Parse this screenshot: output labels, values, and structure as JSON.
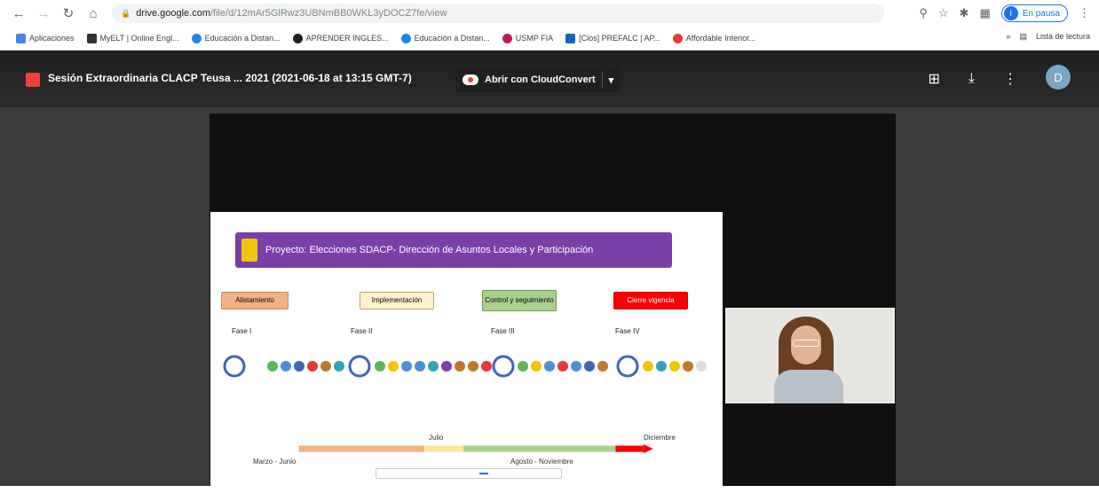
{
  "browser": {
    "url_host": "drive.google.com",
    "url_path": "/file/d/12mAr5GlRwz3UBNmBB0WKL3yDOCZ7fe/view",
    "profile_status": "En pausa",
    "profile_initial": "I",
    "bookmarks": [
      {
        "label": "Aplicaciones",
        "color": "#4285f4"
      },
      {
        "label": "MyELT | Online Engl...",
        "color": "#333333"
      },
      {
        "label": "Educación a Distan...",
        "color": "#1e88e5"
      },
      {
        "label": "APRENDER INGLES...",
        "color": "#222222"
      },
      {
        "label": "Educación a Distan...",
        "color": "#1e88e5"
      },
      {
        "label": "USMP FIA",
        "color": "#c2185b"
      },
      {
        "label": "[Clos] PREFALC | AP...",
        "color": "#1565c0"
      },
      {
        "label": "Affordable Interior...",
        "color": "#e53935"
      }
    ],
    "reading_list": "Lista de lectura"
  },
  "viewer": {
    "file_title": "Sesión Extraordinaria CLACP Teusa ... 2021 (2021-06-18 at 13:15 GMT-7)",
    "open_with_label": "Abrir con CloudConvert",
    "account_initial": "D"
  },
  "slide": {
    "title": "Proyecto: Elecciones SDACP- Dirección de Asuntos Locales y Participación",
    "phases": [
      {
        "label": "Alistamiento",
        "color": "#f4b183"
      },
      {
        "label": "Implementación",
        "color": "#fff2cc"
      },
      {
        "label": "Control y seguimiento",
        "color": "#a9d18e"
      },
      {
        "label": "Cierre vigencia",
        "color": "#ff0000"
      }
    ],
    "fases": [
      "Fase I",
      "Fase II",
      "Fase III",
      "Fase IV"
    ],
    "month_labels": {
      "julio": "Julio",
      "diciembre": "Diciembre",
      "marzo_junio": "Marzo - Junio",
      "agosto_noviembre": "Agosto - Noviembre"
    }
  }
}
